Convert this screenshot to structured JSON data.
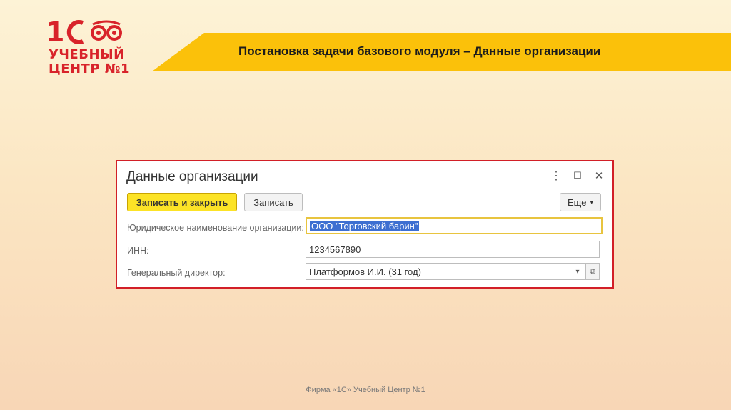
{
  "logo": {
    "line1": "УЧЕБНЫЙ",
    "line2": "ЦЕНТР №1",
    "icon": "1c-logo-icon"
  },
  "slide": {
    "title": "Постановка задачи базового модуля – Данные организации",
    "footer": "Фирма «1С» Учебный Центр №1"
  },
  "window": {
    "title": "Данные организации",
    "controls": {
      "more_icon": "⋮",
      "maximize_icon": "☐",
      "close_icon": "✕"
    },
    "toolbar": {
      "save_close": "Записать и закрыть",
      "save": "Записать",
      "more": "Еще",
      "more_arrow": "▾"
    },
    "fields": {
      "org_name_label": "Юридическое наименование организации:",
      "org_name_value": "ООО \"Торговский барин\"",
      "inn_label": "ИНН:",
      "inn_value": "1234567890",
      "director_label": "Генеральный директор:",
      "director_value": "Платформов И.И. (31 год)",
      "director_dropdown": "▾",
      "director_open": "⧉"
    }
  },
  "colors": {
    "accent_red": "#d21f27",
    "banner_yellow": "#fbc10a",
    "primary_button": "#fce326",
    "selection_blue": "#3d6fd1"
  }
}
